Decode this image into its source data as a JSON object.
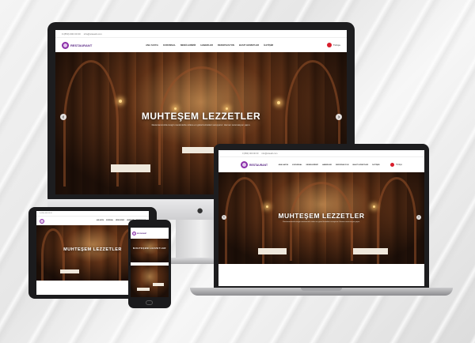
{
  "site": {
    "topbar_phone": "0 (850) 000 00 00",
    "topbar_email": "info@siteadi.com",
    "logo_text": "RESTAURANT",
    "logo_tagline": "lezzetin adresi",
    "menu": [
      "ANA SAYFA",
      "KURUMSAL",
      "MENÜLERİMİZ",
      "HABERLER",
      "REZERVASYON",
      "BASIT HIZMETLER",
      "İLETİŞİM"
    ],
    "language": "Türkçe",
    "hero_title": "MUHTEŞEM LEZZETLER",
    "hero_subtitle": "Restoranımızda zengin menümüzle sizlere en güzel lezzetleri sunuyoruz. Hemen rezervasyon yapın.",
    "prev_arrow": "‹",
    "next_arrow": "›"
  },
  "devices": {
    "desktop_logo": ""
  },
  "colors": {
    "brand": "#8b2fa8",
    "flag": "#d81e2c"
  }
}
